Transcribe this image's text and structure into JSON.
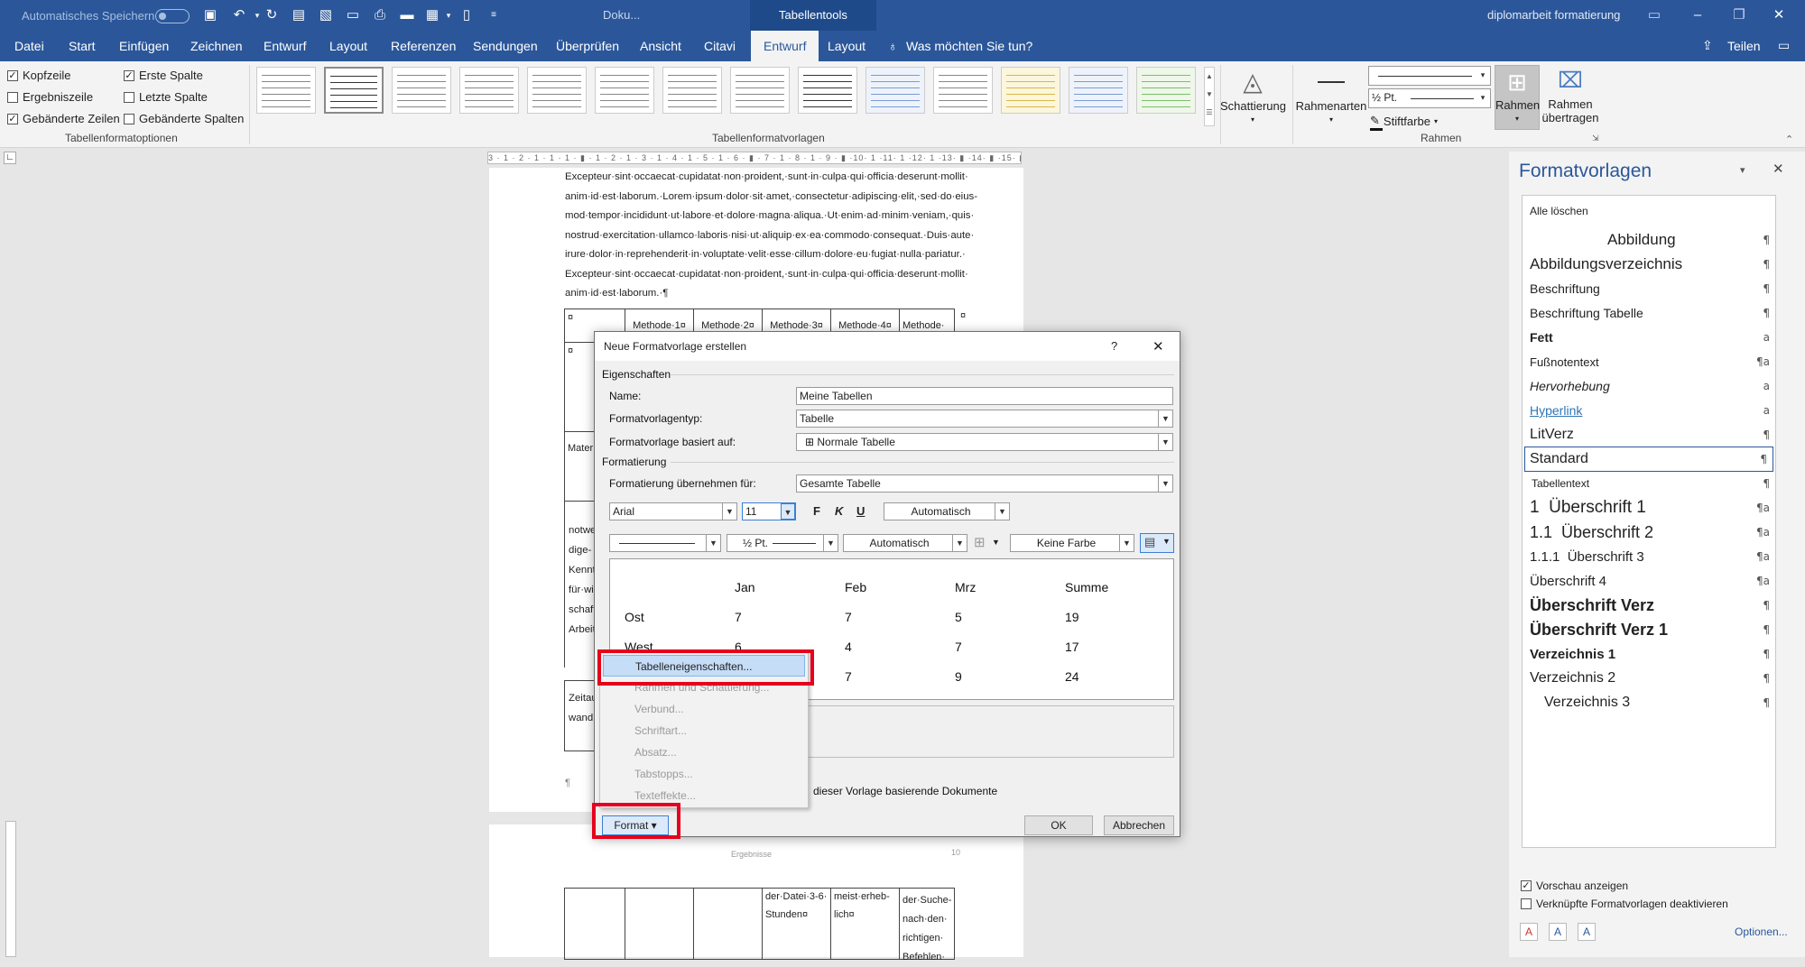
{
  "titlebar": {
    "autosave_label": "Automatisches Speichern",
    "doc_title": "Doku...",
    "context_title": "Tabellentools",
    "filename": "diplomarbeit formatierung"
  },
  "tabs": [
    "Datei",
    "Start",
    "Einfügen",
    "Zeichnen",
    "Entwurf",
    "Layout",
    "Referenzen",
    "Sendungen",
    "Überprüfen",
    "Ansicht",
    "Citavi",
    "Entwurf",
    "Layout"
  ],
  "tell_me": "Was möchten Sie tun?",
  "share": "Teilen",
  "ribbon": {
    "options": {
      "kopfzeile": "Kopfzeile",
      "ergebniszeile": "Ergebniszeile",
      "gebaenderte_zeilen": "Gebänderte Zeilen",
      "erste_spalte": "Erste Spalte",
      "letzte_spalte": "Letzte Spalte",
      "gebaenderte_spalten": "Gebänderte Spalten",
      "group_label": "Tabellenformatoptionen"
    },
    "styles_group_label": "Tabellenformatvorlagen",
    "schattierung": "Schattierung",
    "rahmenarten": "Rahmenarten",
    "pen_weight": "½ Pt.",
    "stiftfarbe": "Stiftfarbe",
    "rahmen": "Rahmen",
    "rahmen_uebertragen_1": "Rahmen",
    "rahmen_uebertragen_2": "übertragen",
    "rahmen_group_label": "Rahmen"
  },
  "ruler_text": "3 · 1 · 2 · 1 · 1 · 1 · ▮ · 1 · 2 · 1 · 3 · 1 · 4 · 1 · 5 · 1 · 6 · ▮ · 7 · 1 · 8 · 1 · 9 · ▮ ·10· 1 ·11· 1 ·12· 1 ·13· ▮ ·14· ▮ ·15· ▮ ·16· ▮ ·17· ▮",
  "document": {
    "lines": [
      "Excepteur·sint·occaecat·cupidatat·non·proident,·sunt·in·culpa·qui·officia·deserunt·mollit·",
      "anim·id·est·laborum.·Lorem·ipsum·dolor·sit·amet,·consectetur·adipiscing·elit,·sed·do·eius-",
      "mod·tempor·incididunt·ut·labore·et·dolore·magna·aliqua.·Ut·enim·ad·minim·veniam,·quis·",
      "nostrud·exercitation·ullamco·laboris·nisi·ut·aliquip·ex·ea·commodo·consequat.·Duis·aute·",
      "irure·dolor·in·reprehenderit·in·voluptate·velit·esse·cillum·dolore·eu·fugiat·nulla·pariatur.·",
      "Excepteur·sint·occaecat·cupidatat·non·proident,·sunt·in·culpa·qui·officia·deserunt·mollit·",
      "anim·id·est·laborum.·¶"
    ],
    "table_header": [
      "¤",
      "Methode·1¤",
      "Methode·2¤",
      "Methode·3¤",
      "Methode·4¤",
      "Methode·"
    ],
    "left_cells": [
      "¤",
      "Mater",
      "notwe",
      "dige-",
      "Kennt",
      "für·wi",
      "schaft",
      "Arbeit",
      "Zeitau",
      "wand"
    ],
    "para_mark": "¶",
    "page2_header": "Ergebnisse",
    "page2_pagenum": "10",
    "page2_cells": [
      [
        "der·Datei·3-6·",
        "Stunden¤"
      ],
      [
        "meist·erheb-",
        "lich¤"
      ],
      [
        "der·Suche-",
        "nach·den·",
        "richtigen·",
        "Befehlen·"
      ]
    ]
  },
  "pane": {
    "title": "Formatvorlagen",
    "clear_all": "Alle löschen",
    "items": [
      {
        "name": "Abbildung",
        "mark": "¶"
      },
      {
        "name": "Abbildungsverzeichnis",
        "mark": "¶"
      },
      {
        "name": "Beschriftung",
        "mark": "¶"
      },
      {
        "name": "Beschriftung Tabelle",
        "mark": "¶"
      },
      {
        "name": "Fett",
        "mark": "a"
      },
      {
        "name": "Fußnotentext",
        "mark": "¶a"
      },
      {
        "name": "Hervorhebung",
        "mark": "a"
      },
      {
        "name": "Hyperlink",
        "mark": "a"
      },
      {
        "name": "LitVerz",
        "mark": "¶"
      },
      {
        "name": "Standard",
        "mark": "¶"
      },
      {
        "name": "Tabellentext",
        "mark": "¶"
      },
      {
        "name": "1  Überschrift 1",
        "mark": "¶a"
      },
      {
        "name": "1.1  Überschrift 2",
        "mark": "¶a"
      },
      {
        "name": "1.1.1  Überschrift 3",
        "mark": "¶a"
      },
      {
        "name": "Überschrift 4",
        "mark": "¶a"
      },
      {
        "name": "Überschrift Verz",
        "mark": "¶"
      },
      {
        "name": "Überschrift Verz 1",
        "mark": "¶"
      },
      {
        "name": "Verzeichnis 1",
        "mark": "¶"
      },
      {
        "name": "Verzeichnis 2",
        "mark": "¶"
      },
      {
        "name": "Verzeichnis 3",
        "mark": "¶"
      }
    ],
    "preview_label": "Vorschau anzeigen",
    "linked_label": "Verknüpfte Formatvorlagen deaktivieren",
    "options_link": "Optionen..."
  },
  "dialog": {
    "title": "Neue Formatvorlage erstellen",
    "help": "?",
    "close": "✕",
    "props_header": "Eigenschaften",
    "name_label": "Name:",
    "name_value": "Meine Tabellen",
    "type_label": "Formatvorlagentyp:",
    "type_value": "Tabelle",
    "based_label": "Formatvorlage basiert auf:",
    "based_value": "⊞  Normale Tabelle",
    "format_header": "Formatierung",
    "apply_label": "Formatierung übernehmen für:",
    "apply_value": "Gesamte Tabelle",
    "font": "Arial",
    "size": "11",
    "bold": "F",
    "italic": "K",
    "underline": "U",
    "color": "Automatisch",
    "line_weight": "½ Pt.",
    "border_color": "Automatisch",
    "shading": "Keine Farbe",
    "preview": {
      "header": [
        "",
        "Jan",
        "Feb",
        "Mrz",
        "Summe"
      ],
      "rows": [
        [
          "Ost",
          "7",
          "7",
          "5",
          "19"
        ],
        [
          "West",
          "6",
          "4",
          "7",
          "17"
        ],
        [
          "",
          "",
          "7",
          "9",
          "24"
        ]
      ]
    },
    "checkbox_tail": "dieser Vorlage basierende Dokumente",
    "ok": "OK",
    "cancel": "Abbrechen",
    "format_btn": "Format ▾"
  },
  "format_menu": [
    "Tabelleneigenschaften...",
    "Rahmen und Schattierung...",
    "Verbund...",
    "Schriftart...",
    "Absatz...",
    "Tabstopps...",
    "Texteffekte..."
  ],
  "colors": {
    "accent": "#2b579a",
    "highlight": "#e5001d"
  }
}
